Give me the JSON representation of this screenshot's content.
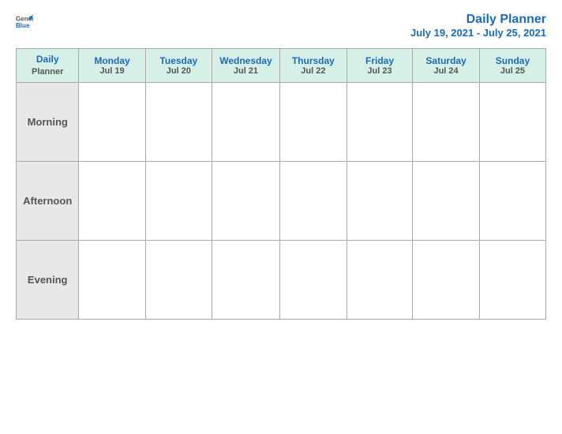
{
  "header": {
    "logo_general": "General",
    "logo_blue": "Blue",
    "title": "Daily Planner",
    "date_range": "July 19, 2021 - July 25, 2021"
  },
  "table": {
    "first_col_header_line1": "Daily",
    "first_col_header_line2": "Planner",
    "columns": [
      {
        "day": "Monday",
        "date": "Jul 19"
      },
      {
        "day": "Tuesday",
        "date": "Jul 20"
      },
      {
        "day": "Wednesday",
        "date": "Jul 21"
      },
      {
        "day": "Thursday",
        "date": "Jul 22"
      },
      {
        "day": "Friday",
        "date": "Jul 23"
      },
      {
        "day": "Saturday",
        "date": "Jul 24"
      },
      {
        "day": "Sunday",
        "date": "Jul 25"
      }
    ],
    "rows": [
      {
        "label": "Morning"
      },
      {
        "label": "Afternoon"
      },
      {
        "label": "Evening"
      }
    ]
  }
}
